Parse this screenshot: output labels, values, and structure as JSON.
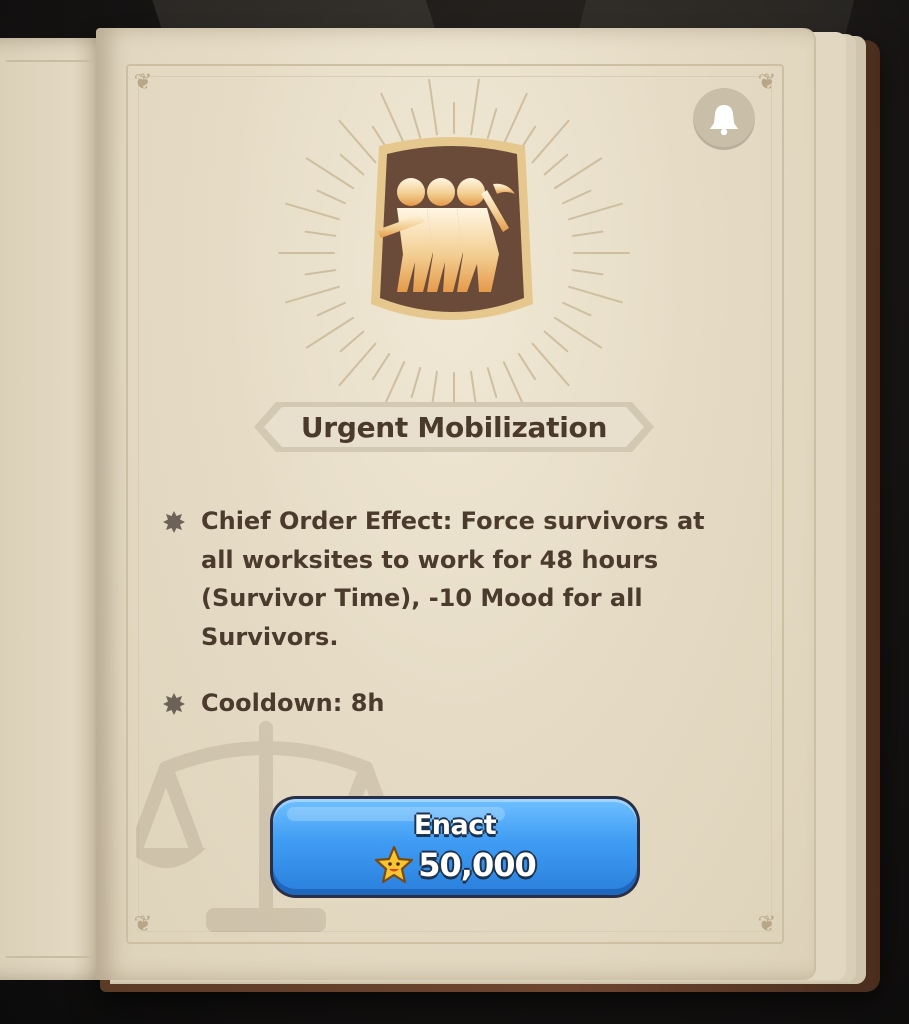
{
  "panel": {
    "title": "Urgent Mobilization",
    "icon": "marching-survivors-icon",
    "bell_icon": "bell-icon"
  },
  "effects": [
    {
      "text": "Chief Order Effect: Force survivors at all worksites to work for 48 hours (Survivor Time), -10 Mood for all Survivors."
    },
    {
      "text": "Cooldown: 8h"
    }
  ],
  "enact_button": {
    "label": "Enact",
    "cost": "50,000",
    "currency_icon": "star-coin-icon"
  },
  "colors": {
    "page": "#e6dcc6",
    "text": "#4b3b2d",
    "button": "#3f9cf3",
    "badge": "#6a4b3a",
    "badge_border": "#e6c88f"
  }
}
